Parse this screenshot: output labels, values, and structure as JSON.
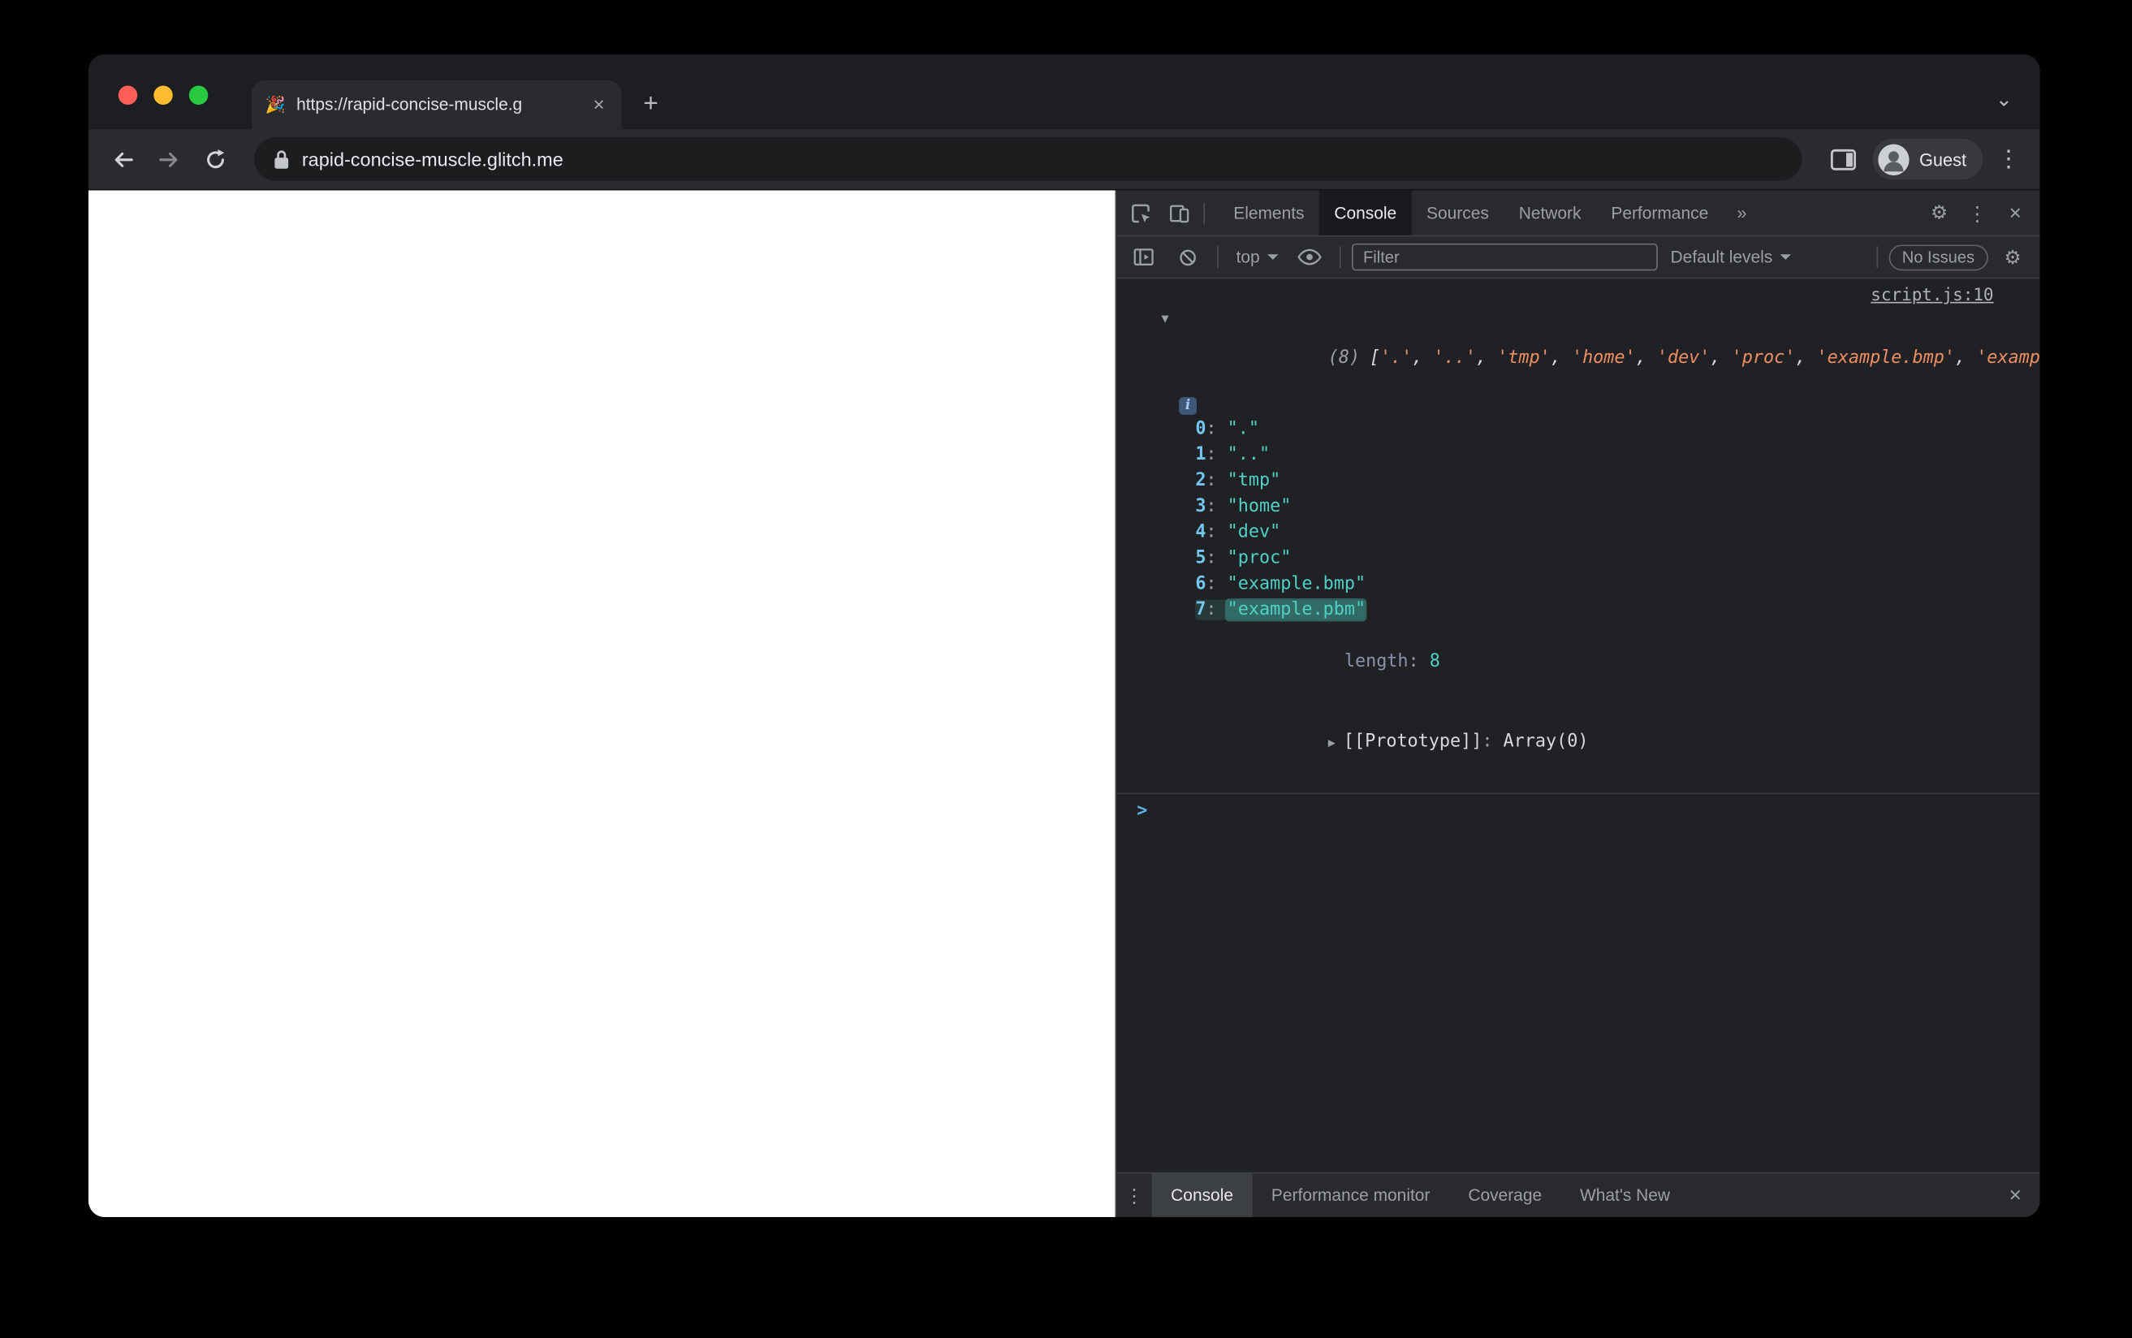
{
  "browser": {
    "tab": {
      "favicon": "🎉",
      "title": "https://rapid-concise-muscle.g"
    },
    "address": {
      "url": "rapid-concise-muscle.glitch.me"
    },
    "profile": {
      "name": "Guest"
    }
  },
  "devtools": {
    "panel_tabs": [
      {
        "label": "Elements",
        "active": false
      },
      {
        "label": "Console",
        "active": true
      },
      {
        "label": "Sources",
        "active": false
      },
      {
        "label": "Network",
        "active": false
      },
      {
        "label": "Performance",
        "active": false
      }
    ],
    "toolbar": {
      "context_selector": "top",
      "filter_placeholder": "Filter",
      "levels_selector": "Default levels",
      "issues_badge": "No Issues"
    },
    "console": {
      "source_link": "script.js:10",
      "preview_count": "(8)",
      "preview_open": "[",
      "preview_close": "]",
      "item_separator": ", ",
      "preview_items": [
        "'.'",
        "'..'",
        "'tmp'",
        "'home'",
        "'dev'",
        "'proc'",
        "'example.bmp'",
        "'example.pbm'"
      ],
      "index_separator": ": ",
      "entries": [
        {
          "index": "0",
          "value": "\".\""
        },
        {
          "index": "1",
          "value": "\"..\""
        },
        {
          "index": "2",
          "value": "\"tmp\""
        },
        {
          "index": "3",
          "value": "\"home\""
        },
        {
          "index": "4",
          "value": "\"dev\""
        },
        {
          "index": "5",
          "value": "\"proc\""
        },
        {
          "index": "6",
          "value": "\"example.bmp\""
        },
        {
          "index": "7",
          "value": "\"example.pbm\"",
          "highlighted": true
        }
      ],
      "length_label": "length",
      "length_value": "8",
      "prototype_label": "[[Prototype]]",
      "prototype_separator": ": ",
      "prototype_value": "Array(0)",
      "prompt_symbol": ">"
    },
    "drawer": {
      "tabs": [
        {
          "label": "Console",
          "active": true
        },
        {
          "label": "Performance monitor",
          "active": false
        },
        {
          "label": "Coverage",
          "active": false
        },
        {
          "label": "What's New",
          "active": false
        }
      ]
    }
  },
  "icons": {
    "tab_close": "✕",
    "new_tab": "+",
    "window_chevron": "⌄",
    "menu_kebab": "⋮",
    "settings_gear": "⚙",
    "more_tabs": "»",
    "close": "✕",
    "expander_open": "▼",
    "expander_closed": "▶",
    "info": "i"
  },
  "colors": {
    "devtools_background": "#202124",
    "devtools_toolbar": "#292a2d",
    "preview_string": "#ef8e63",
    "entry_index": "#72c6ef",
    "entry_value": "#4fd1c5",
    "prompt": "#5fb4e8",
    "traffic_red": "#ff5f57",
    "traffic_yellow": "#febc2e",
    "traffic_green": "#28c840"
  }
}
